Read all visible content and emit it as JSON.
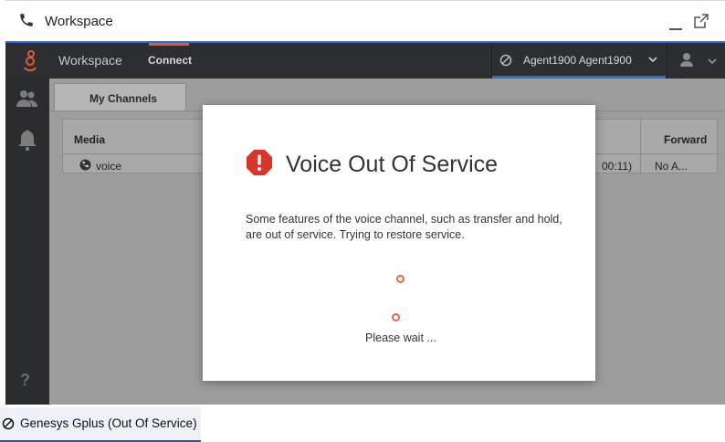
{
  "window": {
    "title": "Workspace",
    "minimize_icon": "minimize-icon",
    "popout_icon": "popout-icon",
    "phone_icon": "phone-icon"
  },
  "topnav": {
    "workspace_label": "Workspace",
    "connect_label": "Connect",
    "agent_name": "Agent1900 Agent1900",
    "accent": "#e05a3a",
    "highlight": "#2f6fd0"
  },
  "sidebar": {
    "items": [
      "contacts-icon",
      "notification-bell-icon"
    ],
    "help_label": "?"
  },
  "channels": {
    "tab_label": "My Channels",
    "columns": {
      "media": "Media",
      "forward": "Forward"
    },
    "rows": [
      {
        "media": "voice",
        "time": "00:11)",
        "forward": "No A..."
      }
    ]
  },
  "modal": {
    "title": "Voice Out Of Service",
    "message": "Some features of the voice channel, such as transfer and hold, are out of service. Trying to restore service.",
    "wait_label": "Please wait ...",
    "error_color": "#d9352b",
    "spinner_color": "#e8673f"
  },
  "statusbar": {
    "label": "Genesys Gplus (Out Of Service)"
  }
}
